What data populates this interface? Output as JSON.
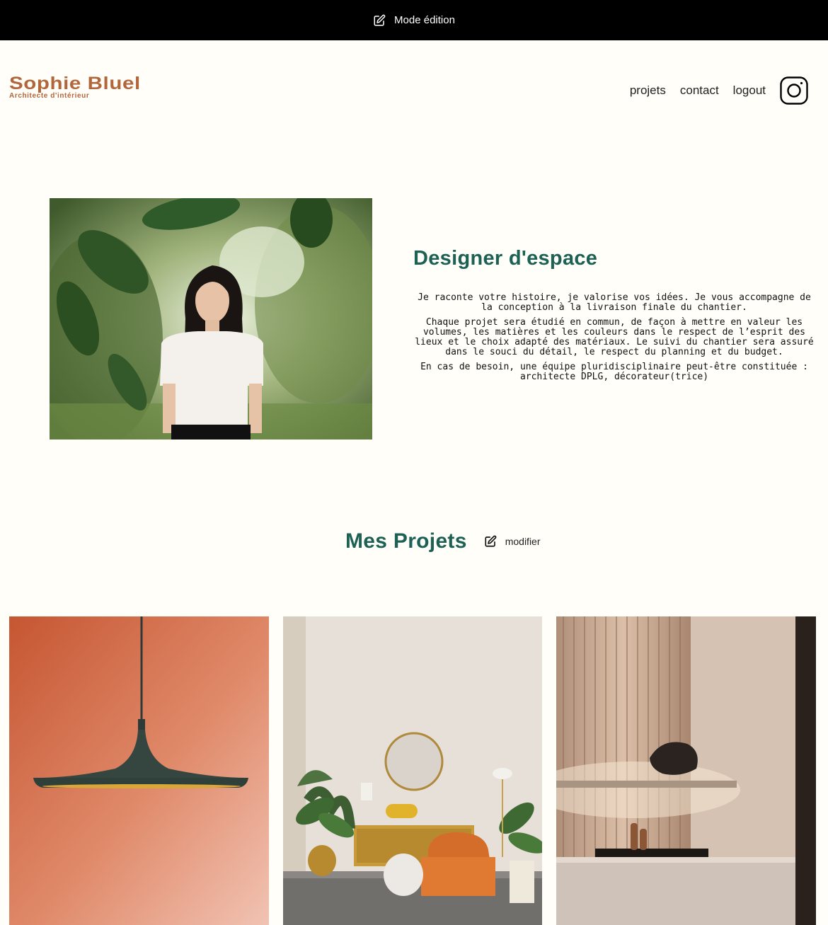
{
  "edit_bar": {
    "label": "Mode édition",
    "icon": "edit-icon"
  },
  "header": {
    "logo_title": "Sophie Bluel",
    "logo_subtitle": "Architecte d'intérieur",
    "nav": [
      "projets",
      "contact",
      "logout"
    ],
    "instagram_icon": "instagram-icon"
  },
  "intro": {
    "title": "Designer d'espace",
    "paragraphs": [
      "Je raconte votre histoire, je valorise vos idées. Je vous accompagne de la conception à la livraison finale du chantier.",
      "Chaque projet sera étudié en commun, de façon à mettre en valeur les volumes, les matières et les couleurs dans le respect de l’esprit des lieux et le choix adapté des matériaux. Le suivi du chantier sera assuré dans le souci du détail, le respect du planning et du budget.",
      "En cas de besoin, une équipe pluridisciplinaire peut-être constituée : architecte DPLG, décorateur(trice)"
    ]
  },
  "projects": {
    "title": "Mes Projets",
    "modify_label": "modifier"
  },
  "colors": {
    "brand": "#B1663C",
    "heading": "#1D6154",
    "background": "#FFFEF8"
  }
}
